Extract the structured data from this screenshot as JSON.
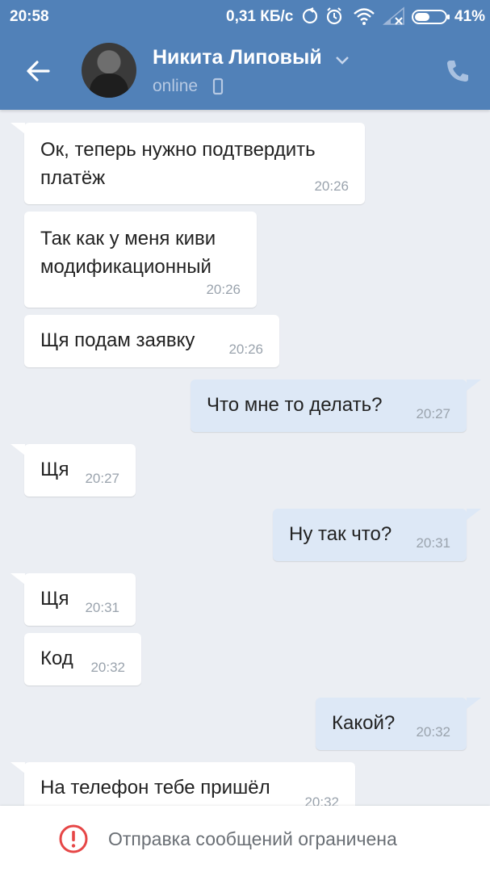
{
  "status_bar": {
    "time": "20:58",
    "speed": "0,31 КБ/с",
    "battery": "41%",
    "icons": [
      "sync-icon",
      "alarm-icon",
      "wifi-icon",
      "signal-icon",
      "battery-icon"
    ]
  },
  "header": {
    "contact_name": "Никита Липовый",
    "status": "online",
    "icons": [
      "back-arrow-icon",
      "chevron-down-icon",
      "mobile-icon",
      "phone-icon"
    ]
  },
  "messages": [
    {
      "dir": "in",
      "text": [
        "Ок, теперь нужно подтвердить",
        "платёж"
      ],
      "time": "20:26"
    },
    {
      "dir": "in",
      "text": [
        "Так как у меня киви",
        "модификационный"
      ],
      "time": "20:26"
    },
    {
      "dir": "in",
      "text": [
        "Щя подам заявку"
      ],
      "time": "20:26"
    },
    {
      "dir": "out",
      "text": [
        "Что мне то делать?"
      ],
      "time": "20:27"
    },
    {
      "dir": "in",
      "text": [
        "Щя"
      ],
      "time": "20:27"
    },
    {
      "dir": "out",
      "text": [
        "Ну так что?"
      ],
      "time": "20:31"
    },
    {
      "dir": "in",
      "text": [
        "Щя"
      ],
      "time": "20:31"
    },
    {
      "dir": "in",
      "text": [
        "Код"
      ],
      "time": "20:32"
    },
    {
      "dir": "out",
      "text": [
        "Какой?"
      ],
      "time": "20:32"
    },
    {
      "dir": "in",
      "text": [
        "На телефон тебе пришёл"
      ],
      "time": "20:32"
    }
  ],
  "bottom_bar": {
    "notice": "Отправка сообщений ограничена",
    "icon": "warning-icon"
  },
  "colors": {
    "header_bg": "#5181b8",
    "chat_bg": "#ebeef3",
    "incoming_bubble": "#ffffff",
    "outgoing_bubble": "#dde8f6",
    "warning_red": "#e64646"
  }
}
